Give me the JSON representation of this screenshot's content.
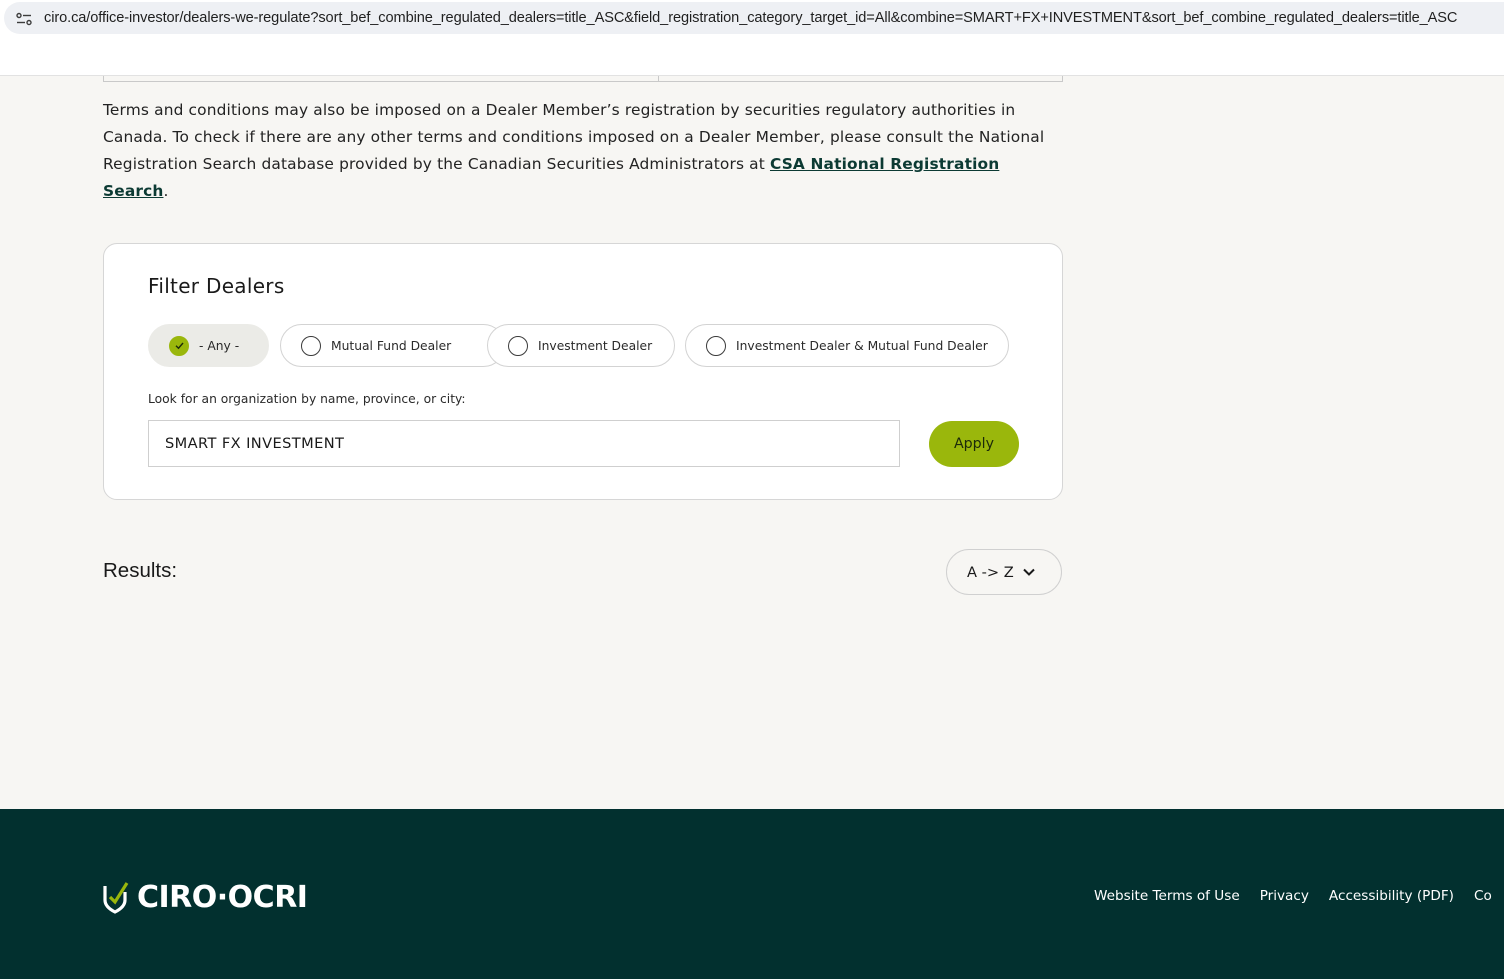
{
  "browser": {
    "url": "ciro.ca/office-investor/dealers-we-regulate?sort_bef_combine_regulated_dealers=title_ASC&field_registration_category_target_id=All&combine=SMART+FX+INVESTMENT&sort_bef_combine_regulated_dealers=title_ASC"
  },
  "terms": {
    "text": "Terms and conditions may also be imposed on a Dealer Member’s registration by securities regulatory authorities in Canada. To check if there are any other terms and conditions imposed on a Dealer Member, please consult the National Registration Search database provided by the Canadian Securities Administrators at ",
    "link_label": "CSA National Registration Search",
    "suffix": "."
  },
  "filter": {
    "title": "Filter Dealers",
    "options": [
      {
        "label": "- Any -",
        "selected": true
      },
      {
        "label": "Mutual Fund Dealer",
        "selected": false
      },
      {
        "label": "Investment Dealer",
        "selected": false
      },
      {
        "label": "Investment Dealer & Mutual Fund Dealer",
        "selected": false
      }
    ],
    "search_label": "Look for an organization by name, province, or city:",
    "search_value": "SMART FX INVESTMENT",
    "apply_label": "Apply"
  },
  "results": {
    "label": "Results:",
    "sort_value": "A -> Z"
  },
  "footer": {
    "logo_text": "CIRO·OCRI",
    "links": [
      "Website Terms of Use",
      "Privacy",
      "Accessibility (PDF)",
      "Co"
    ]
  },
  "colors": {
    "accent": "#9ab70c",
    "footer_bg": "#02302f",
    "link": "#0c3a33"
  }
}
